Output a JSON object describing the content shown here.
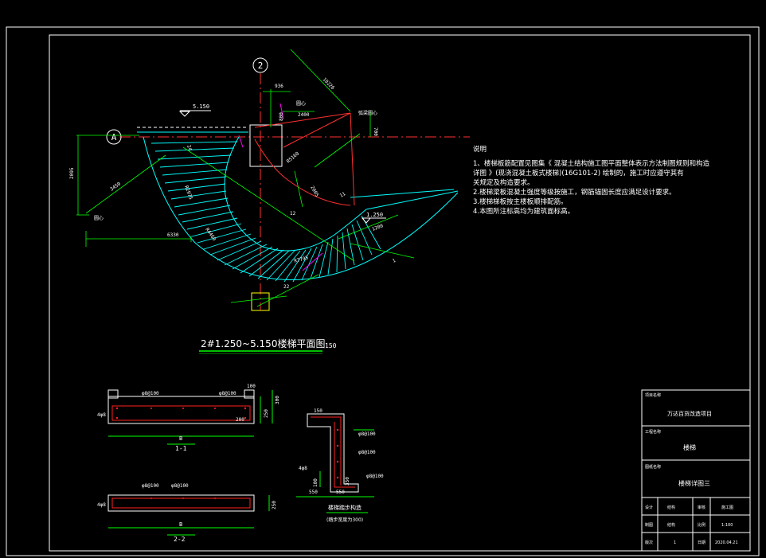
{
  "plan": {
    "title": "2#1.250~5.150楼梯平面图",
    "scale": "150",
    "axis_a": "A",
    "axis_2": "2",
    "dims": {
      "top_936": "936",
      "d_10226": "10226",
      "d_3450": "3450",
      "d_1350": "1350",
      "d_2095": "2095",
      "d_6330": "6330",
      "d_2400": "2400",
      "d_700": "700",
      "d_800": "800",
      "d_r1": "R2975",
      "d_r2": "R4460",
      "d_arc_lower": "R7795",
      "d_r3": "R5160",
      "d_2005": "2005",
      "d_11": "11",
      "d_12": "12",
      "d_22": "22",
      "d_24": "24",
      "d_12b": "12",
      "d_1200": "1200",
      "d_1a": "1"
    },
    "levels": {
      "top": "5.150",
      "right": "1.250"
    },
    "labels": {
      "center": "圆心",
      "left_center": "圆心",
      "arc_center": "弧梁圆心"
    }
  },
  "notes": {
    "heading": "说明",
    "items": [
      "1、楼梯板筋配置见图集《 混凝土结构施工图平面整体表示方法制图规则和构造",
      "   详图 》(现浇混凝土板式楼梯)(16G101-2) 绘制的，施工时应遵守其有",
      "   关规定及构造要求。",
      "2.楼梯梁板混凝土强度等级按施工，钢筋锚固长度应满足设计要求。",
      "3.楼梯梯板按主楼板顺排配筋。",
      "4.本图所注标高均为建筑面标高。"
    ]
  },
  "sections": {
    "s1": {
      "label": "1-1",
      "base": "B",
      "top_rebar": "φ8@100",
      "top_rebar2": "φ8@100",
      "bottom": "4φ8",
      "d100": "100",
      "d200": "200",
      "d250": "250",
      "d300": "300"
    },
    "s2": {
      "label": "2-2",
      "base": "B",
      "top_rebar": "φ8@100",
      "top_rebar2": "φ8@100",
      "bottom": "4φ8",
      "d250": "250"
    },
    "detail": {
      "title": "楼梯踏步构造",
      "subtitle": "(踏步宽度为300)",
      "r1": "φ8@100",
      "r2": "φ8@100",
      "r3": "φ8@100",
      "r4": "4φ8",
      "d550": "550",
      "d550b": "550",
      "d100": "100",
      "d150": "150",
      "d350": "350"
    }
  },
  "title_block": {
    "project_label": "项目名称",
    "project": "万达百货改造项目",
    "drawing_label": "工程名称",
    "drawing": "楼梯",
    "sheet_label": "图纸名称",
    "sheet": "楼梯详图三",
    "row1": [
      "设计",
      "结构",
      "审核",
      "施工图"
    ],
    "row2": [
      "制图",
      "结构",
      "比例",
      "1:100"
    ],
    "row3": [
      "版次",
      "1",
      "日期",
      "2020.04.21"
    ]
  },
  "colors": {
    "background": "#000000",
    "frame": "#ffffff",
    "stair": "#00ffff",
    "dimension": "#00ff00",
    "axis": "#ff0000",
    "text": "#ffffff",
    "yellow": "#ffff00",
    "rebar": "#ff2020",
    "magenta": "#ff00ff"
  }
}
